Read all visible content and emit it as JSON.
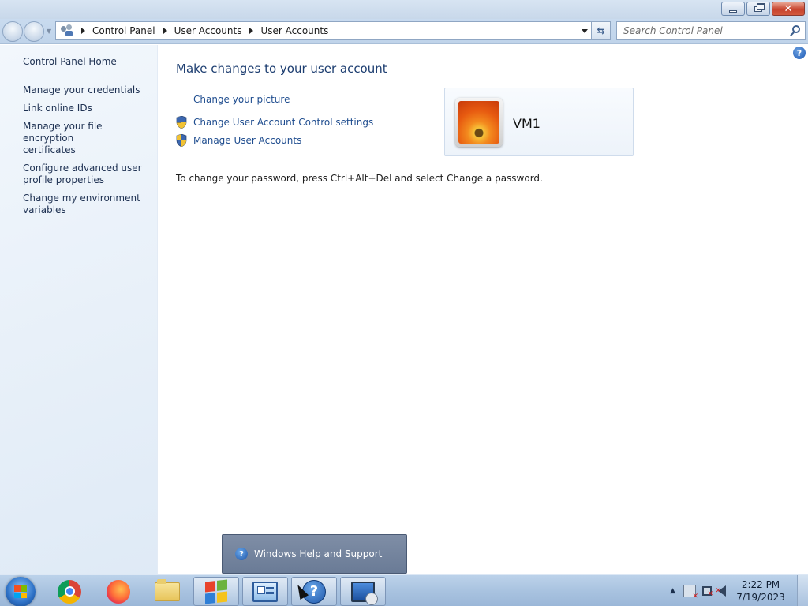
{
  "window": {
    "controls": {
      "minimize_icon": "minimize-icon",
      "maximize_icon": "restore-icon",
      "close_glyph": "✕"
    }
  },
  "nav": {
    "breadcrumbs": [
      "Control Panel",
      "User Accounts",
      "User Accounts"
    ],
    "refresh_glyph": "⇆",
    "search_placeholder": "Search Control Panel"
  },
  "sidebar": {
    "home": "Control Panel Home",
    "links": [
      {
        "label": "Manage your credentials"
      },
      {
        "label": "Link online IDs"
      },
      {
        "label": "Manage your file encryption certificates",
        "lines": [
          "Manage your file encryption",
          "certificates"
        ]
      },
      {
        "label": "Configure advanced user profile properties",
        "lines": [
          "Configure advanced user",
          "profile properties"
        ]
      },
      {
        "label": "Change my environment variables",
        "lines": [
          "Change my environment",
          "variables"
        ]
      }
    ]
  },
  "main": {
    "help_glyph": "?",
    "title": "Make changes to your user account",
    "tasks": [
      {
        "label": "Change your picture",
        "shield": false
      },
      {
        "label": "Change User Account Control settings",
        "shield": true
      },
      {
        "label": "Manage User Accounts",
        "shield": true
      }
    ],
    "password_note": "To change your password, press Ctrl+Alt+Del and select Change a password.",
    "user": {
      "name": "VM1",
      "avatar_icon": "flower-avatar-icon"
    }
  },
  "taskbar": {
    "items": [
      "start-orb",
      "chrome-icon",
      "firefox-icon",
      "explorer-folder-icon",
      "windows-logo-icon",
      "control-panel-icon",
      "help-support-icon",
      "remote-desktop-icon"
    ],
    "tooltip": "Windows Help and Support",
    "tooltip_glyph": "?",
    "help_glyph": "?",
    "tray_chevron": "▲",
    "time": "2:22 PM",
    "date": "7/19/2023"
  },
  "colors": {
    "link": "#1f4d8f",
    "title": "#1c3d70",
    "sidebar_bg": "#e8f0f9",
    "taskbar": "#a9c3e0"
  }
}
